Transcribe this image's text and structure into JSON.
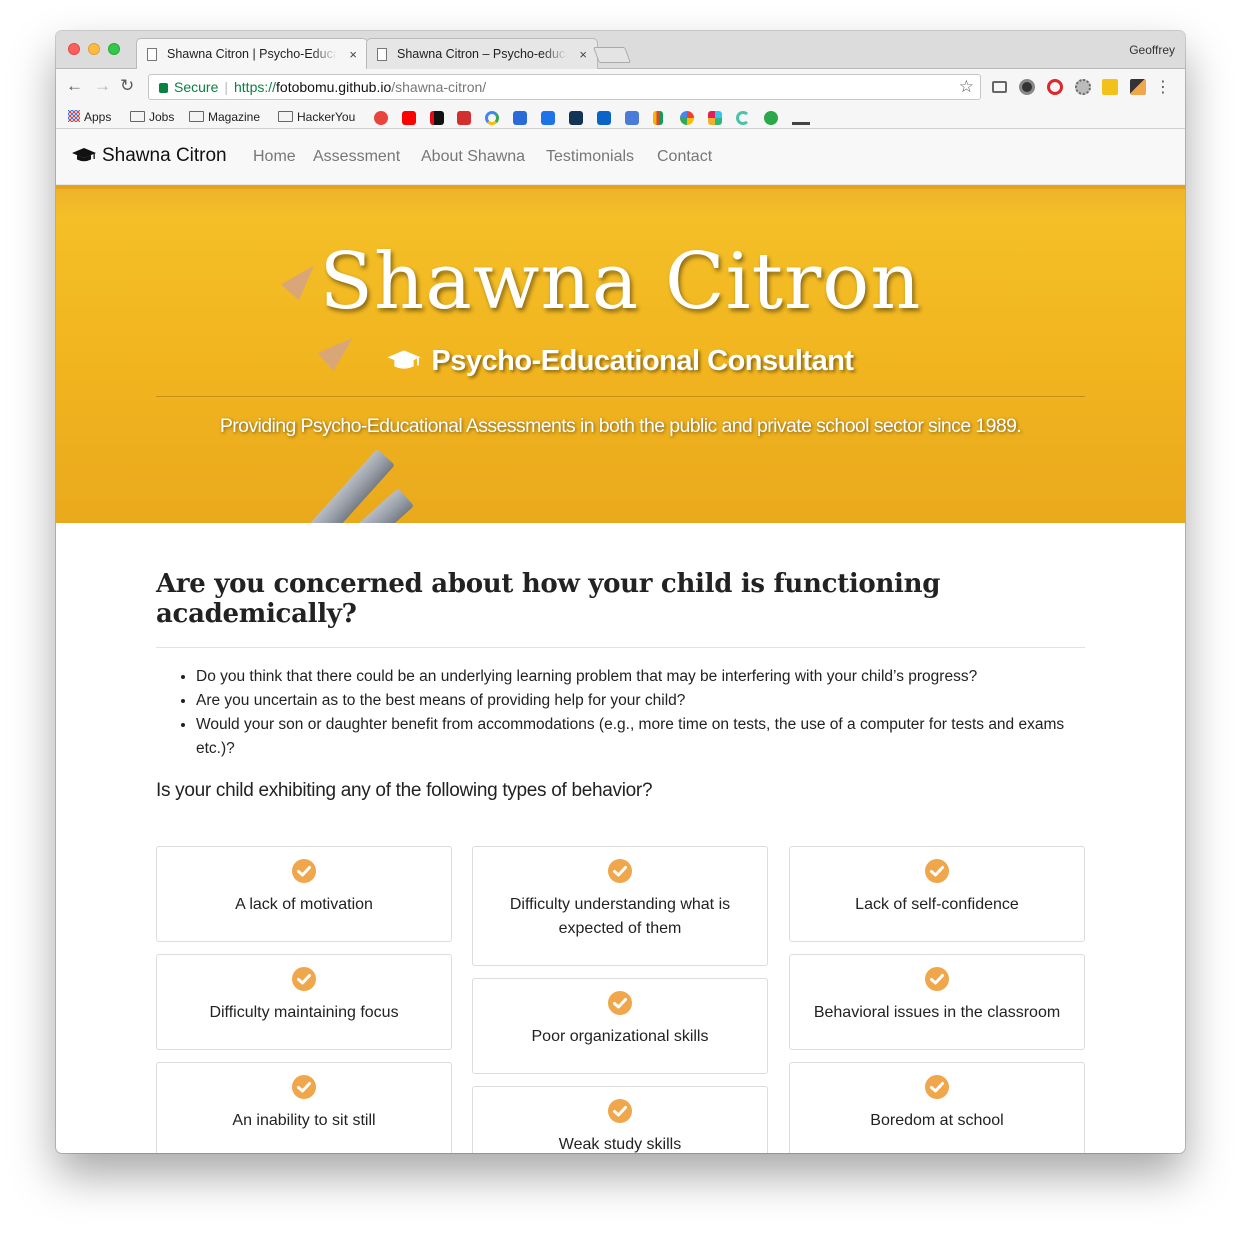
{
  "browser": {
    "tabs": [
      {
        "title": "Shawna Citron | Psycho-Educa",
        "close": "×"
      },
      {
        "title": "Shawna Citron – Psycho-educa",
        "close": "×"
      }
    ],
    "profile": "Geoffrey",
    "omnibox": {
      "secure_label": "Secure",
      "url_scheme": "https://",
      "url_host": "fotobomu.github.io",
      "url_path": "/shawna-citron/"
    },
    "bookmarks": [
      "Apps",
      "Jobs",
      "Magazine",
      "HackerYou"
    ]
  },
  "site": {
    "brand": "Shawna Citron",
    "nav": [
      "Home",
      "Assessment",
      "About Shawna",
      "Testimonials",
      "Contact"
    ],
    "hero": {
      "title": "Shawna Citron",
      "subtitle": "Psycho-Educational Consultant",
      "tagline": "Providing Psycho-Educational Assessments in both the public and private school sector since 1989."
    },
    "concern_heading": "Are you concerned about how your child is functioning academically?",
    "bullets": [
      "Do you think that there could be an underlying learning problem that may be interfering with your child’s progress?",
      "Are you uncertain as to the best means of providing help for your child?",
      "Would your son or daughter benefit from accommodations (e.g., more time on tests, the use of a computer for tests and exams etc.)?"
    ],
    "behavior_question": "Is your child exhibiting any of the following types of behavior?",
    "behaviors": {
      "col1": [
        "A lack of motivation",
        "Difficulty maintaining focus",
        "An inability to sit still"
      ],
      "col2": [
        "Difficulty understanding what is expected of them",
        "Poor organizational skills",
        "Weak study skills"
      ],
      "col3": [
        "Lack of self-confidence",
        "Behavioral issues in the classroom",
        "Boredom at school"
      ]
    }
  },
  "colors": {
    "accent_check": "#f0a64b",
    "hero_yellow": "#f1b41f",
    "secure_green": "#0b8043"
  }
}
